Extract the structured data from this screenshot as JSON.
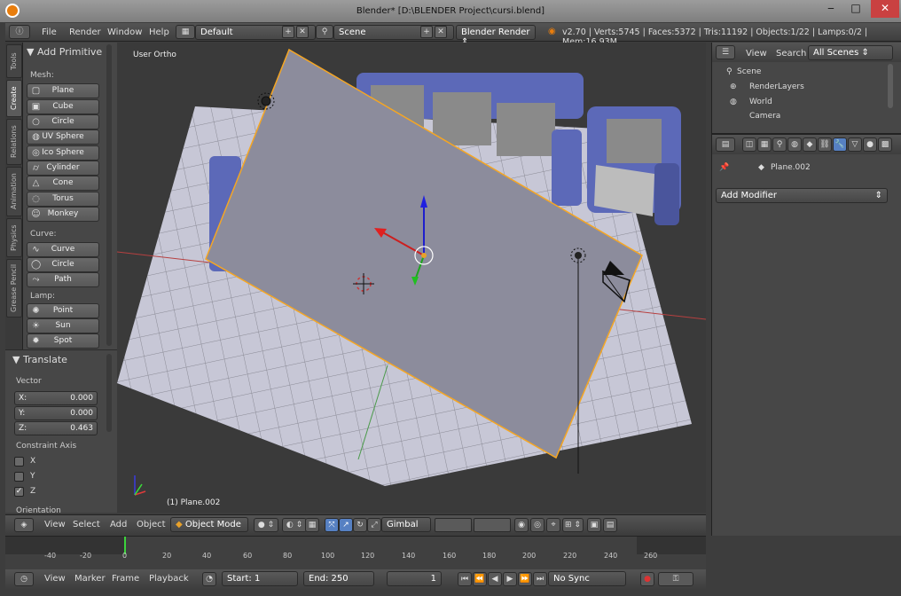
{
  "window": {
    "title": "Blender* [D:\\BLENDER Project\\cursi.blend]"
  },
  "menubar": {
    "menus": [
      "File",
      "Render",
      "Window",
      "Help"
    ],
    "layout": "Default",
    "scene": "Scene",
    "engine": "Blender Render",
    "stats": "v2.70 | Verts:5745 | Faces:5372 | Tris:11192 | Objects:1/22 | Lamps:0/2 | Mem:16.93M"
  },
  "left_tabs": [
    "Tools",
    "Create",
    "Relations",
    "Animation",
    "Physics",
    "Grease Pencil"
  ],
  "toolshelf": {
    "title": "Add Primitive",
    "mesh_label": "Mesh:",
    "mesh": [
      "Plane",
      "Cube",
      "Circle",
      "UV Sphere",
      "Ico Sphere",
      "Cylinder",
      "Cone",
      "Torus",
      "Monkey"
    ],
    "curve_label": "Curve:",
    "curve": [
      "Curve",
      "Circle",
      "Path"
    ],
    "lamp_label": "Lamp:",
    "lamp": [
      "Point",
      "Sun",
      "Spot"
    ]
  },
  "operator": {
    "title": "Translate",
    "vector_label": "Vector",
    "x_label": "X:",
    "x": "0.000",
    "y_label": "Y:",
    "y": "0.000",
    "z_label": "Z:",
    "z": "0.463",
    "constraint_label": "Constraint Axis",
    "axes": [
      "X",
      "Y",
      "Z"
    ],
    "z_checked": "✓",
    "orientation_label": "Orientation"
  },
  "viewport": {
    "view_name": "User Ortho",
    "object_label": "(1) Plane.002"
  },
  "outliner": {
    "view": "View",
    "search": "Search",
    "filter": "All Scenes",
    "items": [
      "Scene",
      "RenderLayers",
      "World",
      "Camera"
    ]
  },
  "properties": {
    "object": "Plane.002",
    "add_modifier": "Add Modifier"
  },
  "vp_header": {
    "menus": [
      "View",
      "Select",
      "Add",
      "Object"
    ],
    "mode": "Object Mode",
    "orientation": "Gimbal"
  },
  "timeline": {
    "ticks": [
      "-40",
      "-20",
      "0",
      "20",
      "40",
      "60",
      "80",
      "100",
      "120",
      "140",
      "160",
      "180",
      "200",
      "220",
      "240",
      "260"
    ],
    "menus": [
      "View",
      "Marker",
      "Frame",
      "Playback"
    ],
    "start": "Start: 1",
    "end": "End: 250",
    "current": "1",
    "sync": "No Sync"
  },
  "colors": {
    "accent": "#e87d0d",
    "selected_outline": "#f5a623",
    "active_tool": "#5680c2"
  }
}
